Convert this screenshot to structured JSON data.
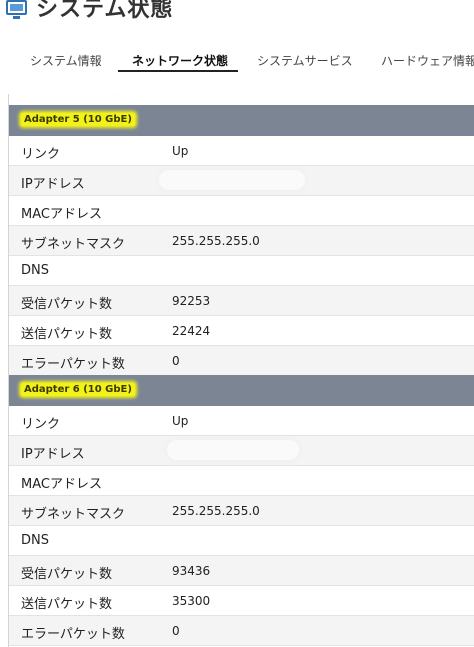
{
  "title": "システム状態",
  "tabs": [
    {
      "label": "システム情報",
      "active": false
    },
    {
      "label": "ネットワーク状態",
      "active": true
    },
    {
      "label": "システムサービス",
      "active": false
    },
    {
      "label": "ハードウェア情報",
      "active": false
    }
  ],
  "partial_row": {
    "key": "エラーパケット数",
    "value": "0"
  },
  "adapters": [
    {
      "title": "Adapter 5 (10 GbE)",
      "rows": [
        {
          "key": "リンク",
          "value": "Up"
        },
        {
          "key": "IPアドレス",
          "value": ""
        },
        {
          "key": "MACアドレス",
          "value": ""
        },
        {
          "key": "サブネットマスク",
          "value": "255.255.255.0"
        },
        {
          "key": "DNS",
          "value": ""
        },
        {
          "key": "受信パケット数",
          "value": "92253"
        },
        {
          "key": "送信パケット数",
          "value": "22424"
        },
        {
          "key": "エラーパケット数",
          "value": "0"
        }
      ]
    },
    {
      "title": "Adapter 6 (10 GbE)",
      "rows": [
        {
          "key": "リンク",
          "value": "Up"
        },
        {
          "key": "IPアドレス",
          "value": ""
        },
        {
          "key": "MACアドレス",
          "value": ""
        },
        {
          "key": "サブネットマスク",
          "value": "255.255.255.0"
        },
        {
          "key": "DNS",
          "value": ""
        },
        {
          "key": "受信パケット数",
          "value": "93436"
        },
        {
          "key": "送信パケット数",
          "value": "35300"
        },
        {
          "key": "エラーパケット数",
          "value": "0"
        }
      ]
    }
  ],
  "colors": {
    "header_bg": "#7c8594",
    "highlight": "#f2f21a",
    "row_alt": "#f4f4f4"
  }
}
